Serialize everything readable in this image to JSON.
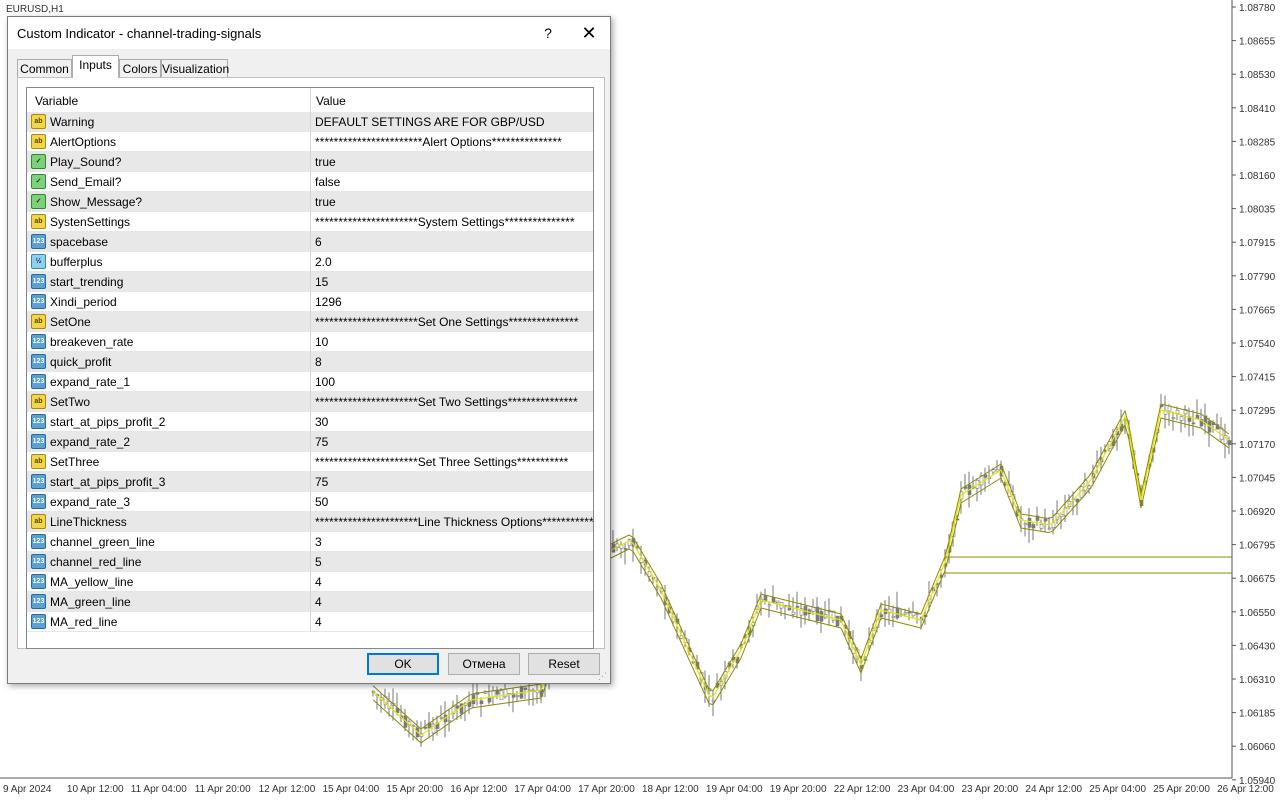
{
  "chart": {
    "symbol": "EURUSD,H1",
    "price_labels": [
      "1.08780",
      "1.08655",
      "1.08530",
      "1.08410",
      "1.08285",
      "1.08160",
      "1.08035",
      "1.07915",
      "1.07790",
      "1.07665",
      "1.07540",
      "1.07415",
      "1.07295",
      "1.07170",
      "1.07045",
      "1.06920",
      "1.06795",
      "1.06675",
      "1.06550",
      "1.06430",
      "1.06310",
      "1.06185",
      "1.06060",
      "1.05940"
    ],
    "time_labels": [
      "9 Apr 2024",
      "10 Apr 12:00",
      "11 Apr 04:00",
      "11 Apr 20:00",
      "12 Apr 12:00",
      "15 Apr 04:00",
      "15 Apr 20:00",
      "16 Apr 12:00",
      "17 Apr 04:00",
      "17 Apr 20:00",
      "18 Apr 12:00",
      "19 Apr 04:00",
      "19 Apr 20:00",
      "22 Apr 12:00",
      "23 Apr 04:00",
      "23 Apr 20:00",
      "24 Apr 12:00",
      "25 Apr 04:00",
      "25 Apr 20:00",
      "26 Apr 12:00"
    ],
    "colors": {
      "channel_line": "#8b8b00",
      "ma_yellow": "#e6e600",
      "candle": "#7a7a7a"
    }
  },
  "dialog": {
    "title": "Custom Indicator - channel-trading-signals",
    "help": "?",
    "close": "✕",
    "tabs": [
      {
        "label": "Common"
      },
      {
        "label": "Inputs"
      },
      {
        "label": "Colors"
      },
      {
        "label": "Visualization"
      }
    ],
    "active_tab": "Inputs",
    "grid": {
      "col_variable": "Variable",
      "col_value": "Value",
      "rows": [
        {
          "icon": "ab",
          "name": "Warning",
          "value": "DEFAULT SETTINGS ARE FOR GBP/USD"
        },
        {
          "icon": "ab",
          "name": "AlertOptions",
          "value": "***********************Alert Options***************"
        },
        {
          "icon": "bool",
          "name": "Play_Sound?",
          "value": "true"
        },
        {
          "icon": "bool",
          "name": "Send_Email?",
          "value": "false"
        },
        {
          "icon": "bool",
          "name": "Show_Message?",
          "value": "true"
        },
        {
          "icon": "ab",
          "name": "SystenSettings",
          "value": "**********************System Settings***************"
        },
        {
          "icon": "num",
          "name": "spacebase",
          "value": "6"
        },
        {
          "icon": "frac",
          "name": "bufferplus",
          "value": "2.0"
        },
        {
          "icon": "num",
          "name": "start_trending",
          "value": "15"
        },
        {
          "icon": "num",
          "name": "Xindi_period",
          "value": "1296"
        },
        {
          "icon": "ab",
          "name": "SetOne",
          "value": "**********************Set One Settings***************"
        },
        {
          "icon": "num",
          "name": "breakeven_rate",
          "value": "10"
        },
        {
          "icon": "num",
          "name": "quick_profit",
          "value": "8"
        },
        {
          "icon": "num",
          "name": "expand_rate_1",
          "value": "100"
        },
        {
          "icon": "ab",
          "name": "SetTwo",
          "value": "**********************Set Two Settings***************"
        },
        {
          "icon": "num",
          "name": "start_at_pips_profit_2",
          "value": "30"
        },
        {
          "icon": "num",
          "name": "expand_rate_2",
          "value": "75"
        },
        {
          "icon": "ab",
          "name": "SetThree",
          "value": "**********************Set Three Settings***********"
        },
        {
          "icon": "num",
          "name": "start_at_pips_profit_3",
          "value": "75"
        },
        {
          "icon": "num",
          "name": "expand_rate_3",
          "value": "50"
        },
        {
          "icon": "ab",
          "name": "LineThickness",
          "value": "**********************Line Thickness Options***************"
        },
        {
          "icon": "num",
          "name": "channel_green_line",
          "value": "3"
        },
        {
          "icon": "num",
          "name": "channel_red_line",
          "value": "5"
        },
        {
          "icon": "num",
          "name": "MA_yellow_line",
          "value": "4"
        },
        {
          "icon": "num",
          "name": "MA_green_line",
          "value": "4"
        },
        {
          "icon": "num",
          "name": "MA_red_line",
          "value": "4"
        }
      ]
    },
    "buttons": {
      "ok": "OK",
      "cancel": "Отмена",
      "reset": "Reset"
    }
  }
}
